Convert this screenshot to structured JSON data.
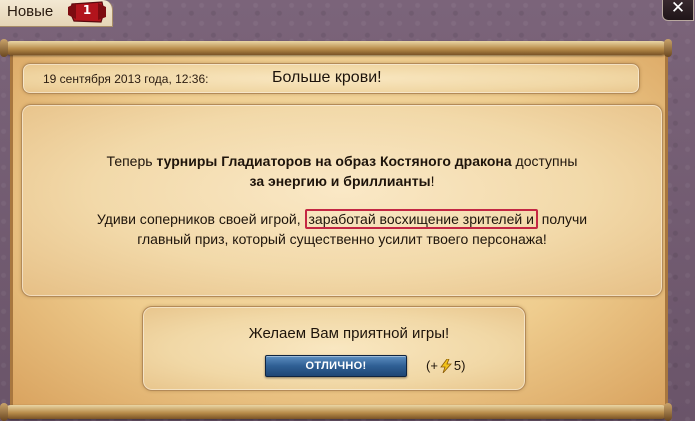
{
  "tab": {
    "label": "Новые",
    "badge_count": "1"
  },
  "close": {
    "symbol": "✕"
  },
  "header": {
    "date": "19 сентября 2013 года, 12:36:",
    "title": "Больше крови!"
  },
  "body": {
    "para1": {
      "part1": "Теперь ",
      "bold1": "турниры Гладиаторов на образ Костяного дракона",
      "part2": " доступны",
      "bold2": "за энергию и бриллианты",
      "part3": "!"
    },
    "para2": {
      "part1": "Удиви соперников своей игрой, ",
      "highlight": "заработай восхищение зрителей и",
      "part2": " получи",
      "line2": "главный приз, который существенно усилит твоего персонажа!"
    }
  },
  "footer": {
    "wish": "Желаем Вам приятной игры!",
    "ok_label": "ОТЛИЧНО!",
    "reward_prefix": "(+",
    "reward_value": "5)"
  },
  "colors": {
    "highlight_border": "#c42743",
    "button": "#2f5f94",
    "background": "#6f5a6f"
  },
  "icons": {
    "energy": "lightning-bolt-icon",
    "close": "close-icon",
    "badge": "notification-badge-icon"
  }
}
